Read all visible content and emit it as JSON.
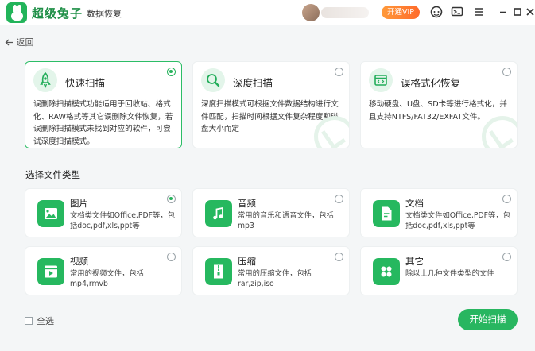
{
  "titlebar": {
    "brand": "超级兔子",
    "product": "数据恢复",
    "vip_label": "开通VIP",
    "accent": "#22b45a",
    "vip_color": "#ff7a2e",
    "icons": [
      "support-icon",
      "feedback-icon",
      "menu-icon",
      "minimize-icon",
      "maximize-icon",
      "close-icon"
    ]
  },
  "nav": {
    "back_label": "返回"
  },
  "modes": [
    {
      "title": "快速扫描",
      "desc": "误删除扫描模式功能适用于回收站、格式化、RAW格式等其它误删除文件恢复，若误删除扫描模式未找到对应的软件，可尝试深度扫描模式。",
      "selected": true,
      "icon": "rocket-icon"
    },
    {
      "title": "深度扫描",
      "desc": "深度扫描模式可根据文件数据结构进行文件匹配，扫描时间根据文件复杂程度和磁盘大小而定",
      "selected": false,
      "icon": "magnifier-icon"
    },
    {
      "title": "误格式化恢复",
      "desc": "移动硬盘、U盘、SD卡等进行格式化，并且支持NTFS/FAT32/EXFAT文件。",
      "selected": false,
      "icon": "format-icon"
    }
  ],
  "types_section_title": "选择文件类型",
  "types": [
    {
      "title": "图片",
      "desc": "文档类文件如Office,PDF等，包括doc,pdf,xls,ppt等",
      "selected": true,
      "icon": "image-icon"
    },
    {
      "title": "音频",
      "desc": "常用的音乐和语音文件，包括mp3",
      "selected": false,
      "icon": "music-icon"
    },
    {
      "title": "文档",
      "desc": "文档类文件如Office,PDF等，包括doc,pdf,xls,ppt等",
      "selected": false,
      "icon": "document-icon"
    },
    {
      "title": "视频",
      "desc": "常用的视频文件，包括mp4,rmvb",
      "selected": false,
      "icon": "video-icon"
    },
    {
      "title": "压缩",
      "desc": "常用的压缩文件，包括rar,zip,iso",
      "selected": false,
      "icon": "archive-icon"
    },
    {
      "title": "其它",
      "desc": "除以上几种文件类型的文件",
      "selected": false,
      "icon": "other-icon"
    }
  ],
  "footer": {
    "select_all_label": "全选",
    "start_label": "开始扫描"
  }
}
